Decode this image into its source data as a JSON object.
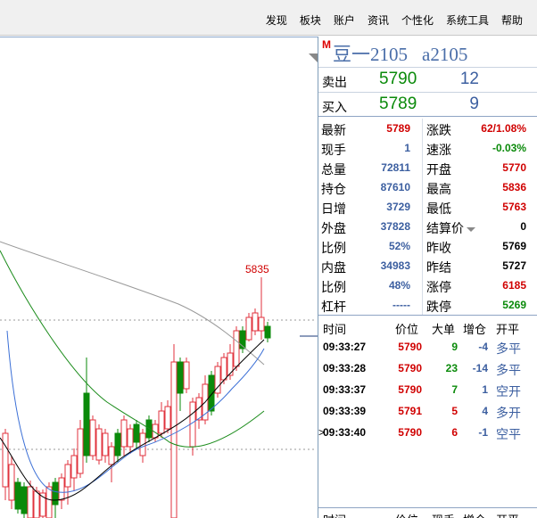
{
  "menu": [
    "发现",
    "板块",
    "账户",
    "资讯",
    "个性化",
    "系统工具",
    "帮助"
  ],
  "chart": {
    "high_label": "5835",
    "colors": {
      "up": "#e0323c",
      "down": "#0a8a0a",
      "ma_black": "#000000",
      "ma_gray": "#999999",
      "ma_blue": "#3b6fd6",
      "ma_green": "#1c8c1c"
    }
  },
  "quote": {
    "badge": "M",
    "name": "豆一2105",
    "code": "a2105",
    "sell": {
      "label": "卖出",
      "price": "5790",
      "volume": "12"
    },
    "buy": {
      "label": "买入",
      "price": "5789",
      "volume": "9"
    },
    "stats": [
      {
        "l1": "最新",
        "v1": "5789",
        "c1": "red",
        "l2": "涨跌",
        "v2": "62/1.08%",
        "c2": "red"
      },
      {
        "l1": "现手",
        "v1": "1",
        "c1": "blue",
        "l2": "速涨",
        "v2": "-0.03%",
        "c2": "green"
      },
      {
        "l1": "总量",
        "v1": "72811",
        "c1": "blue",
        "l2": "开盘",
        "v2": "5770",
        "c2": "red"
      },
      {
        "l1": "持仓",
        "v1": "87610",
        "c1": "blue",
        "l2": "最高",
        "v2": "5836",
        "c2": "red"
      },
      {
        "l1": "日增",
        "v1": "3729",
        "c1": "blue",
        "l2": "最低",
        "v2": "5763",
        "c2": "red"
      },
      {
        "l1": "外盘",
        "v1": "37828",
        "c1": "blue",
        "l2": "结算价",
        "v2": "0",
        "c2": "black",
        "caret": true
      },
      {
        "l1": "比例",
        "v1": "52%",
        "c1": "blue",
        "l2": "昨收",
        "v2": "5769",
        "c2": "black"
      },
      {
        "l1": "内盘",
        "v1": "34983",
        "c1": "blue",
        "l2": "昨结",
        "v2": "5727",
        "c2": "black"
      },
      {
        "l1": "比例",
        "v1": "48%",
        "c1": "blue",
        "l2": "涨停",
        "v2": "6185",
        "c2": "red"
      },
      {
        "l1": "杠杆",
        "v1": "-----",
        "c1": "blue",
        "l2": "跌停",
        "v2": "5269",
        "c2": "green"
      }
    ]
  },
  "ticks": {
    "headers": {
      "time": "时间",
      "price": "价位",
      "big": "大单",
      "delta": "增仓",
      "open_close": "开平"
    },
    "rows": [
      {
        "time": "09:33:27",
        "price": "5790",
        "vol": "9",
        "vcolor": "green",
        "delta": "-4",
        "kind": "多平"
      },
      {
        "time": "09:33:28",
        "price": "5790",
        "vol": "23",
        "vcolor": "green",
        "delta": "-14",
        "kind": "多平"
      },
      {
        "time": "09:33:37",
        "price": "5790",
        "vol": "7",
        "vcolor": "green",
        "delta": "1",
        "kind": "空开"
      },
      {
        "time": "09:33:39",
        "price": "5791",
        "vol": "5",
        "vcolor": "red",
        "delta": "4",
        "kind": "多开"
      },
      {
        "time": "09:33:40",
        "price": "5790",
        "vol": "6",
        "vcolor": "red",
        "delta": "-1",
        "kind": "空平",
        "marker": ">"
      }
    ],
    "headers2": {
      "time": "时间",
      "price": "价位",
      "hand": "现手",
      "delta": "增仓",
      "open_close": "开平"
    }
  }
}
